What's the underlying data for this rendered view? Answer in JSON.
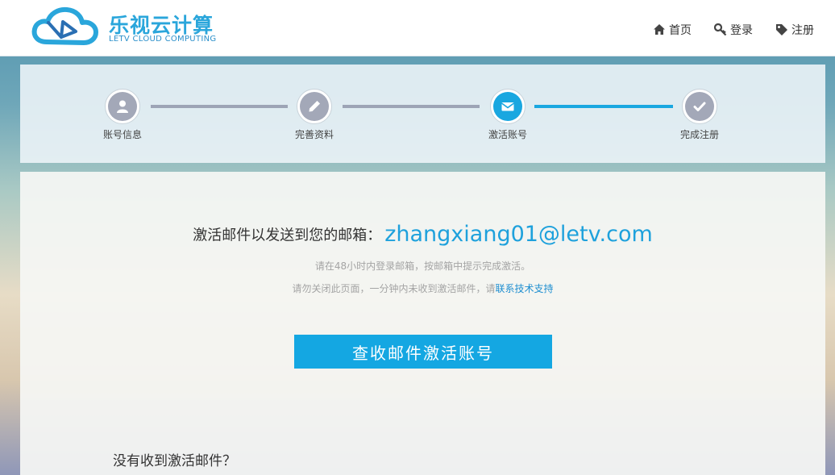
{
  "header": {
    "logo": {
      "cn": "乐视云计算",
      "en": "LETV CLOUD COMPUTING"
    },
    "nav": [
      {
        "label": "首页",
        "icon": "home-icon"
      },
      {
        "label": "登录",
        "icon": "key-icon"
      },
      {
        "label": "注册",
        "icon": "tag-icon"
      }
    ]
  },
  "steps": [
    {
      "label": "账号信息",
      "icon": "user-icon",
      "active": false
    },
    {
      "label": "完善资料",
      "icon": "pencil-icon",
      "active": false
    },
    {
      "label": "激活账号",
      "icon": "envelope-icon",
      "active": true
    },
    {
      "label": "完成注册",
      "icon": "check-icon",
      "active": false
    }
  ],
  "main": {
    "sent_text": "激活邮件以发送到您的邮箱：",
    "email": "zhangxiang01@letv.com",
    "hint1": "请在48小时内登录邮箱，按邮箱中提示完成激活。",
    "hint2_prefix": "请勿关闭此页面，一分钟内未收到激活邮件，请",
    "hint2_link": "联系技术支持",
    "check_button": "查收邮件激活账号",
    "not_received": "没有收到激活邮件？"
  },
  "colors": {
    "accent": "#1aa7e0",
    "step_inactive": "#a3a8b8",
    "link": "#1e8ed0"
  }
}
